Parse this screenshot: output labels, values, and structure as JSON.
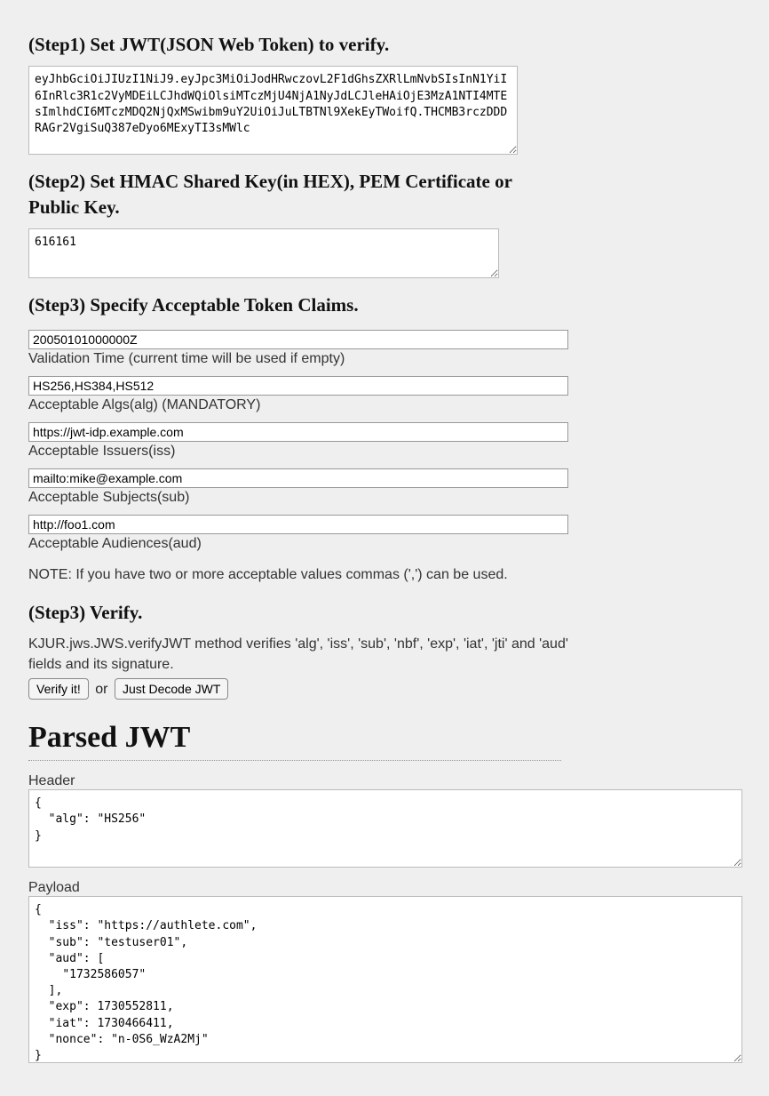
{
  "step1": {
    "heading": "(Step1) Set JWT(JSON Web Token) to verify.",
    "jwt": "eyJhbGciOiJIUzI1NiJ9.eyJpc3MiOiJodHRwczovL2F1dGhsZXRlLmNvbSIsInN1YiI6InRlc3R1c2VyMDEiLCJhdWQiOlsiMTczMjU4NjA1NyJdLCJleHAiOjE3MzA1NTI4MTEsImlhdCI6MTczMDQ2NjQxMSwibm9uY2UiOiJuLTBTNl9XekEyTWoifQ.THCMB3rczDDDRAGr2VgiSuQ387eDyo6MExyTI3sMWlc"
  },
  "step2": {
    "heading": "(Step2) Set HMAC Shared Key(in HEX), PEM Certificate or Public Key.",
    "key": "616161"
  },
  "step3": {
    "heading": "(Step3) Specify Acceptable Token Claims.",
    "validationTime": {
      "value": "20050101000000Z",
      "label": "Validation Time (current time will be used if empty)"
    },
    "algs": {
      "value": "HS256,HS384,HS512",
      "label": "Acceptable Algs(alg) (MANDATORY)"
    },
    "iss": {
      "value": "https://jwt-idp.example.com",
      "label": "Acceptable Issuers(iss)"
    },
    "sub": {
      "value": "mailto:mike@example.com",
      "label": "Acceptable Subjects(sub)"
    },
    "aud": {
      "value": "http://foo1.com",
      "label": "Acceptable Audiences(aud)"
    },
    "note": "NOTE: If you have two or more acceptable values commas (',') can be used."
  },
  "verify": {
    "heading": "(Step3) Verify.",
    "desc": "KJUR.jws.JWS.verifyJWT method verifies 'alg', 'iss', 'sub', 'nbf', 'exp', 'iat', 'jti' and 'aud' fields and its signature.",
    "btn1": "Verify it!",
    "or": "or",
    "btn2": "Just Decode JWT"
  },
  "parsed": {
    "heading": "Parsed JWT",
    "headerLabel": "Header",
    "headerJson": "{\n  \"alg\": \"HS256\"\n}",
    "payloadLabel": "Payload",
    "payloadJson": "{\n  \"iss\": \"https://authlete.com\",\n  \"sub\": \"testuser01\",\n  \"aud\": [\n    \"1732586057\"\n  ],\n  \"exp\": 1730552811,\n  \"iat\": 1730466411,\n  \"nonce\": \"n-0S6_WzA2Mj\"\n}"
  }
}
